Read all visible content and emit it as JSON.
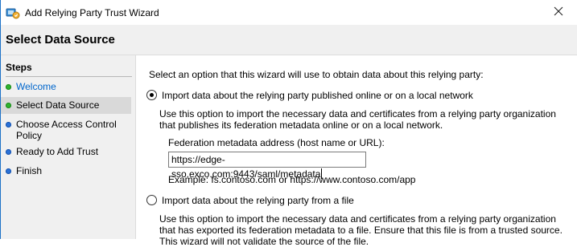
{
  "window": {
    "title": "Add Relying Party Trust Wizard"
  },
  "header": {
    "title": "Select Data Source"
  },
  "steps": {
    "title": "Steps",
    "items": [
      {
        "label": "Welcome",
        "status": "done"
      },
      {
        "label": "Select Data Source",
        "status": "current"
      },
      {
        "label": "Choose Access Control Policy",
        "status": "pending"
      },
      {
        "label": "Ready to Add Trust",
        "status": "pending"
      },
      {
        "label": "Finish",
        "status": "pending"
      }
    ]
  },
  "main": {
    "intro": "Select an option that this wizard will use to obtain data about this relying party:",
    "option_online": {
      "label": "Import data about the relying party published online or on a local network",
      "description": "Use this option to import the necessary data and certificates from a relying party organization that publishes its federation metadata online or on a local network.",
      "selected": true
    },
    "metadata_address": {
      "label": "Federation metadata address (host name or URL):",
      "value": "https://edge-sso.exco.com:9443/saml/metadata",
      "example": "Example: fs.contoso.com or https://www.contoso.com/app"
    },
    "option_file": {
      "label": "Import data about the relying party from a file",
      "description": "Use this option to import the necessary data and certificates from a relying party organization that has exported its federation metadata to a file. Ensure that this file is from a trusted source.  This wizard will not validate the source of the file.",
      "selected": false
    }
  },
  "colors": {
    "done": "#2fb32f",
    "pending": "#2b72d8",
    "link": "#0066cc",
    "selected_row": "#d9d9d9"
  },
  "icons": {
    "app": "adfs-wizard-icon",
    "close": "close-icon"
  }
}
